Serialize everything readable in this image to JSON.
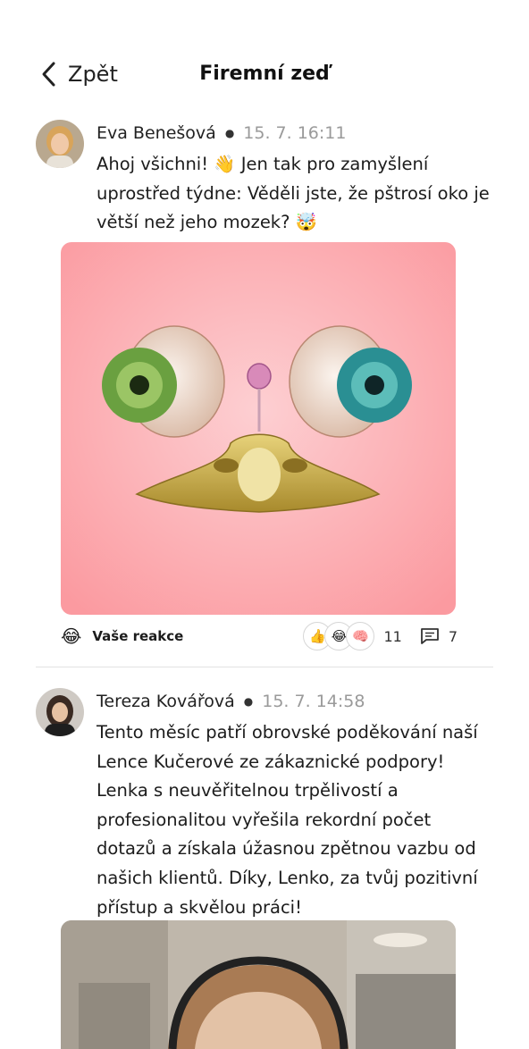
{
  "header": {
    "back_label": "Zpět",
    "title": "Firemní zeď"
  },
  "posts": [
    {
      "author": "Eva Benešová",
      "time": "15. 7. 16:11",
      "text": "Ahoj všichni! 👋 Jen tak pro zamyšlení uprostřed týdne: Věděli jste, že pštrosí oko je větší než jeho mozek? 🤯",
      "image": "surreal ostrich eyes illustration on pink background",
      "my_reaction_emoji": "😂",
      "my_reaction_label": "Vaše reakce",
      "reaction_emojis": [
        "👍",
        "😂",
        "🧠"
      ],
      "reaction_count": "11",
      "comment_count": "7"
    },
    {
      "author": "Tereza Kovářová",
      "time": "15. 7. 14:58",
      "text": "Tento měsíc patří obrovské poděkování naší Lence Kučerové ze zákaznické podpory! Lenka s neuvěřitelnou trpělivostí a profesionalitou vyřešila rekordní počet dotazů a získala úžasnou zpětnou vazbu od našich klientů. Díky, Lenko, za tvůj pozitivní přístup a skvělou práci!",
      "image": "photo of support agent with headset in office"
    }
  ]
}
